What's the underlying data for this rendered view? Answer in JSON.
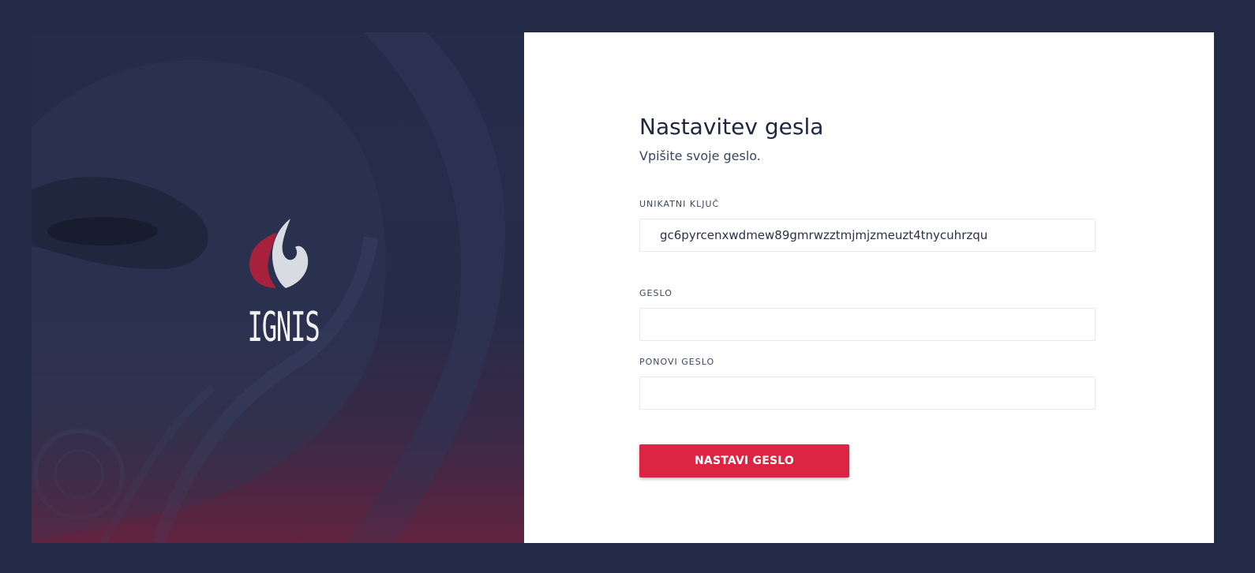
{
  "brand": {
    "name": "IGNIS",
    "colors": {
      "background": "#222a45",
      "accent": "#dc2542",
      "flame_dark": "#a8213c",
      "flame_light": "#d9dbe3"
    },
    "logo_icon": "flame-logo-icon"
  },
  "form": {
    "title": "Nastavitev gesla",
    "subtitle": "Vpišite svoje geslo.",
    "unique_key": {
      "label": "UNIKATNI KLJUČ",
      "value": "gc6pyrcenxwdmew89gmrwzztmjmjzmeuzt4tnycuhrzqu",
      "placeholder": ""
    },
    "password": {
      "label": "GESLO",
      "value": "",
      "placeholder": ""
    },
    "repeat_password": {
      "label": "PONOVI GESLO",
      "value": "",
      "placeholder": ""
    },
    "submit_label": "NASTAVI GESLO"
  }
}
